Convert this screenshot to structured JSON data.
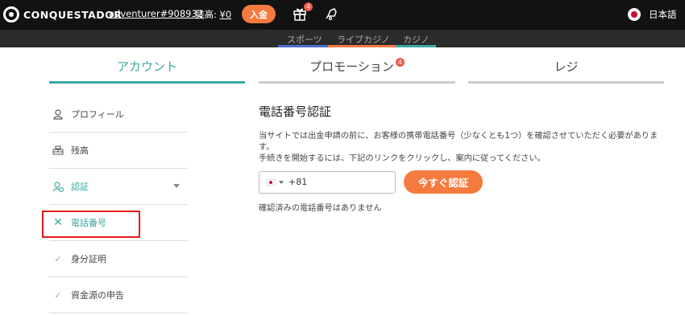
{
  "header": {
    "logo_text": "CONQUESTADOR",
    "username": "adventurer#908932",
    "balance_label": "残高:",
    "balance_value": "¥0",
    "deposit_label": "入金",
    "gift_badge": "4",
    "language": "日本語"
  },
  "subnav": {
    "items": [
      {
        "label": "スポーツ",
        "bar_color": "#4a6fd1"
      },
      {
        "label": "ライブカジノ",
        "bar_color": "#f47a3e"
      },
      {
        "label": "カジノ",
        "bar_color": "#3aa9a0"
      }
    ]
  },
  "tabs": [
    {
      "label": "アカウント",
      "active": true
    },
    {
      "label": "プロモーション",
      "badge": "4"
    },
    {
      "label": "レジ"
    }
  ],
  "sidebar": {
    "items": [
      {
        "label": "プロフィール",
        "icon": "user-icon"
      },
      {
        "label": "残高",
        "icon": "coins-icon"
      },
      {
        "label": "認証",
        "icon": "verify-user-icon",
        "expanded": true
      },
      {
        "label": "電話番号",
        "icon": "close-icon",
        "status": "unverified"
      },
      {
        "label": "身分証明",
        "icon": "check-icon"
      },
      {
        "label": "資金源の申告",
        "icon": "check-icon"
      }
    ]
  },
  "main": {
    "title": "電話番号認証",
    "desc_line1": "当サイトでは出金申請の前に、お客様の携帯電話番号（少なくとも1つ）を確認させていただく必要があります。",
    "desc_line2": "手続きを開始するには、下記のリンクをクリックし、案内に従ってください。",
    "country_code": "+81",
    "verify_button": "今すぐ認証",
    "no_phone_text": "確認済みの電話番号はありません"
  },
  "colors": {
    "accent_teal": "#3aa9a0",
    "accent_orange": "#f47a3e",
    "topbar_bg": "#121212",
    "highlight_red": "#e01b1b"
  }
}
